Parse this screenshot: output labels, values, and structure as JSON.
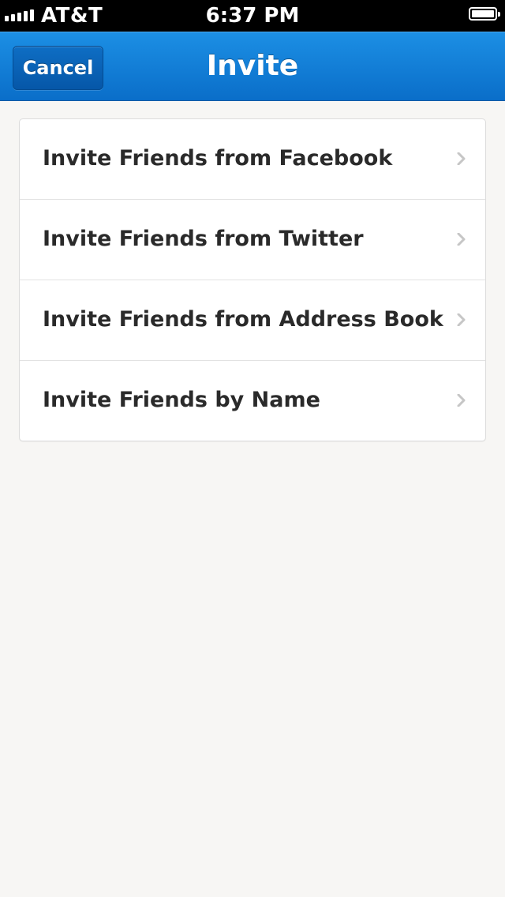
{
  "status_bar": {
    "carrier": "AT&T",
    "time": "6:37 PM",
    "signal_bars": 5,
    "battery_level": 1.0
  },
  "nav": {
    "cancel_label": "Cancel",
    "title": "Invite",
    "accent_color": "#0a6ec9"
  },
  "invite_options": [
    {
      "label": "Invite Friends from Facebook"
    },
    {
      "label": "Invite Friends from Twitter"
    },
    {
      "label": "Invite Friends from Address Book"
    },
    {
      "label": "Invite Friends by Name"
    }
  ],
  "icons": {
    "row_disclosure": "chevron-right-icon",
    "signal": "signal-strength-icon",
    "battery": "battery-icon"
  }
}
